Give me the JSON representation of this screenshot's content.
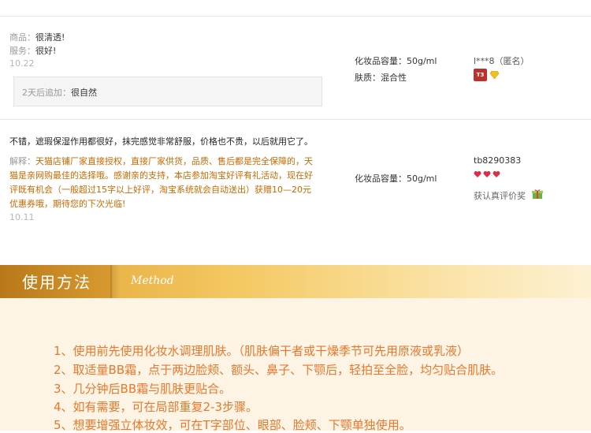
{
  "review1": {
    "product_label": "商品：",
    "product_text": "很清透!",
    "service_label": "服务：",
    "service_text": "很好!",
    "date": "10.22",
    "followup_label": "2天后追加：",
    "followup_text": "很自然",
    "spec_capacity": "化妆品容量：50g/ml",
    "spec_skin": "肤质：混合性",
    "user": "l***8（匿名）",
    "badge_text": "T3"
  },
  "review2": {
    "content": "不错，遮瑕保湿作用都很好，抹完感觉非常舒服，价格也不贵，以后就用它了。",
    "reply_label": "解释：",
    "reply_lines": [
      "天猫店铺厂家直接授权，直接厂家供货，品质、售后都是完全保障的，天",
      "猫是亲网购最佳的选择哦。感谢亲的支持，本店参加淘宝好评有礼活动，现在好",
      "评既有机会（一般超过15字以上好评，淘宝系统就会自动送出）获赠10—20元",
      "优惠券哦，期待您的下次光临!"
    ],
    "date": "10.11",
    "spec_capacity": "化妆品容量：50g/ml",
    "user": "tb8290383",
    "verified": "获认真评价奖"
  },
  "method": {
    "title": "使用方法",
    "script_title": "Method",
    "steps": [
      "1、使用前先使用化妆水调理肌肤。（肌肤偏干者或干燥季节可先用原液或乳液）",
      "2、取适量BB霜，点于两边脸颊、额头、鼻子、下颚后，轻拍至全脸，均匀贴合肌肤。",
      "3、几分钟后BB霜与肌肤更贴合。",
      "4、如有需要，可在局部重复2-3步骤。",
      "5、想要增强立体妆效，可在T字部位、眼部、脸颊、下颚单独使用。"
    ]
  },
  "colors": {
    "accent_orange": "#e8782a",
    "reply_orange": "#c46a00",
    "band_gold": "#e9b347",
    "badge_red": "#c0302a",
    "heart_red": "#d9304a",
    "diamond_gold": "#f2c21b"
  },
  "icons": {
    "rank_badge": "t3-badge-icon",
    "diamond": "diamond-icon",
    "hearts": "heart-rank-icon",
    "gift": "gift-icon"
  }
}
